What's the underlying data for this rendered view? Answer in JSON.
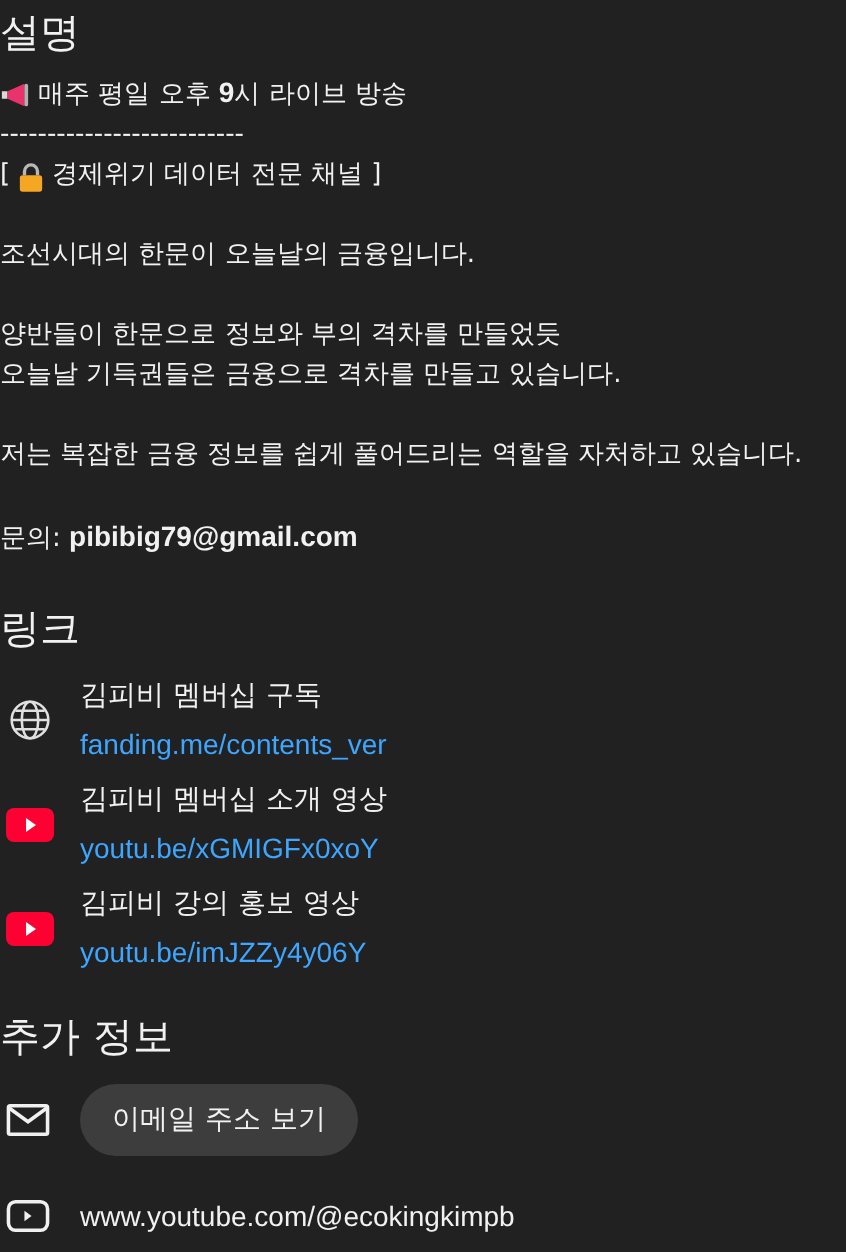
{
  "description": {
    "title": "설명",
    "paragraphs": [
      [
        {
          "kind": "announce",
          "text": "매주 평일 오후 **9**시 라이브 방송"
        },
        {
          "kind": "text",
          "text": "--------------------------"
        },
        {
          "kind": "locked",
          "before": "[",
          "text": "경제위기 데이터 전문 채널 ]"
        }
      ],
      [
        {
          "kind": "text",
          "text": "조선시대의 한문이 오늘날의 금융입니다."
        }
      ],
      [
        {
          "kind": "text",
          "text": "양반들이 한문으로 정보와 부의 격차를 만들었듯"
        },
        {
          "kind": "text",
          "text": "오늘날 기득권들은 금융으로 격차를 만들고 있습니다."
        }
      ],
      [
        {
          "kind": "text",
          "text": "저는 복잡한 금융 정보를 쉽게 풀어드리는 역할을 자처하고 있습니다."
        }
      ],
      [
        {
          "kind": "text",
          "text": "문의: **pibibig79@gmail.com**"
        }
      ]
    ]
  },
  "links": {
    "title": "링크",
    "items": [
      {
        "kind": "web",
        "title": "김피비 멤버십 구독",
        "url": "fanding.me/contents_ver"
      },
      {
        "kind": "youtube",
        "title": "김피비 멤버십 소개 영상",
        "url": "youtu.be/xGMIGFx0xoY"
      },
      {
        "kind": "youtube",
        "title": "김피비 강의 홍보 영상",
        "url": "youtu.be/imJZZy4y06Y"
      }
    ]
  },
  "more_info": {
    "title": "추가 정보",
    "items": [
      {
        "kind": "email",
        "button": "이메일 주소 보기"
      },
      {
        "kind": "channel",
        "text": "www.youtube.com/@ecokingkimpb"
      }
    ]
  }
}
